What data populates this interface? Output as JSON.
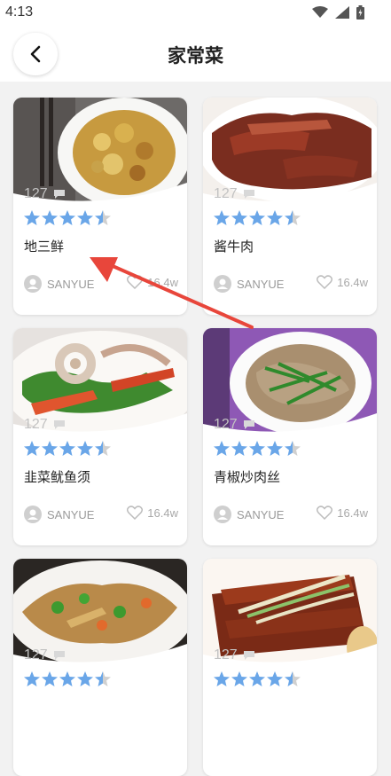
{
  "status_bar": {
    "time": "4:13",
    "icons": [
      "wifi-icon",
      "signal-icon",
      "battery-icon"
    ]
  },
  "header": {
    "title": "家常菜",
    "back_icon": "chevron-left-icon"
  },
  "cards": [
    {
      "name": "地三鲜",
      "comments": "127",
      "rating": 4.5,
      "author": "SANYUE",
      "likes": "16.4w"
    },
    {
      "name": "酱牛肉",
      "comments": "127",
      "rating": 4.5,
      "author": "SANYUE",
      "likes": "16.4w"
    },
    {
      "name": "韭菜鱿鱼须",
      "comments": "127",
      "rating": 4.5,
      "author": "SANYUE",
      "likes": "16.4w"
    },
    {
      "name": "青椒炒肉丝",
      "comments": "127",
      "rating": 4.5,
      "author": "SANYUE",
      "likes": "16.4w"
    },
    {
      "name": "",
      "comments": "127",
      "rating": 4.5,
      "author": "",
      "likes": ""
    },
    {
      "name": "",
      "comments": "127",
      "rating": 4.5,
      "author": "",
      "likes": ""
    }
  ],
  "colors": {
    "star": "#6aa6e8",
    "arrow": "#e8463b",
    "muted": "#c2c2c2"
  }
}
